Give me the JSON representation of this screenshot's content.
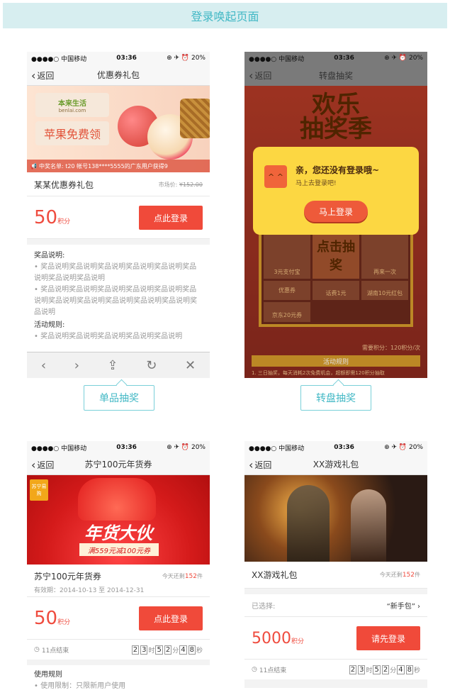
{
  "page_title": "登录唤起页面",
  "status_bar": {
    "carrier": "●●●●○ 中国移动",
    "time": "03:36",
    "battery": "⊕ ✈ ⏰ 20%"
  },
  "back_label": "返回",
  "phone1": {
    "title": "优惠券礼包",
    "brand_cn": "本来生活",
    "brand_url": "benlai.com",
    "promo": "苹果免费领",
    "ticker": "中奖名单: t20 帐号138****5555的广东用户获得9",
    "product": "某某优惠券礼包",
    "market_price_label": "市场价:",
    "market_price": "¥152.00",
    "points": "50",
    "points_unit": "积分",
    "login_button": "点此登录",
    "prize_heading": "奖品说明:",
    "prize_text_1": "• 奖品说明奖品说明奖品说明奖品说明奖品说明奖品说明奖品说明奖品说明",
    "prize_text_2": "• 奖品说明奖品说明奖品说明奖品说明奖品说明奖品说明奖品说明奖品说明奖品说明奖品说明奖品说明奖品说明",
    "rules_heading": "活动规则:",
    "rules_text": "• 奖品说明奖品说明奖品说明奖品说明奖品说明"
  },
  "phone2": {
    "title": "转盘抽奖",
    "banner_line1": "欢乐",
    "banner_line2": "抽奖季",
    "popup_title": "亲，您还没有登录哦~",
    "popup_sub": "马上去登录吧!",
    "popup_button": "马上登录",
    "grid": [
      "3元支付宝",
      "点击抽奖",
      "再来一次",
      "优惠券",
      "话费1元",
      "湖南10元红包",
      "京东20元券"
    ],
    "grid_center": "点击\n抽奖",
    "need_points": "需要积分：120积分/次",
    "rules_bar": "活动规则",
    "rules_text": "1. 三日抽奖，每天消耗2次免费机会，超额即需120积分抽取"
  },
  "label_single": "单品抽奖",
  "label_wheel": "转盘抽奖",
  "phone3": {
    "title": "苏宁100元年货券",
    "badge": "苏宁易购",
    "banner_big": "年货大伙",
    "banner_sub": "满559元减100元券",
    "product": "苏宁100元年货券",
    "remain_prefix": "今天还剩",
    "remain_num": "152",
    "remain_unit": "件",
    "validity": "有效期：2014-10-13 至 2014-12-31",
    "points": "50",
    "points_unit": "积分",
    "login_button": "点此登录",
    "ends": "11点结束",
    "timer": [
      "2",
      "3",
      "时",
      "5",
      "2",
      "分",
      "4",
      "8",
      "秒"
    ],
    "rules_heading": "使用规则",
    "rules_text": "• 使用限制：只限新用户使用"
  },
  "phone4": {
    "title": "XX游戏礼包",
    "product": "XX游戏礼包",
    "remain_prefix": "今天还剩",
    "remain_num": "152",
    "remain_unit": "件",
    "selected_label": "已选择:",
    "selected_value": "“新手包”",
    "points": "5000",
    "points_unit": "积分",
    "login_button": "请先登录",
    "ends": "11点结束",
    "timer": [
      "2",
      "3",
      "时",
      "5",
      "2",
      "分",
      "4",
      "8",
      "秒"
    ]
  },
  "colors": {
    "accent": "#42b8c5",
    "red": "#ef4b3e",
    "yellow": "#fcd742",
    "orange_bg": "#e0533a"
  }
}
